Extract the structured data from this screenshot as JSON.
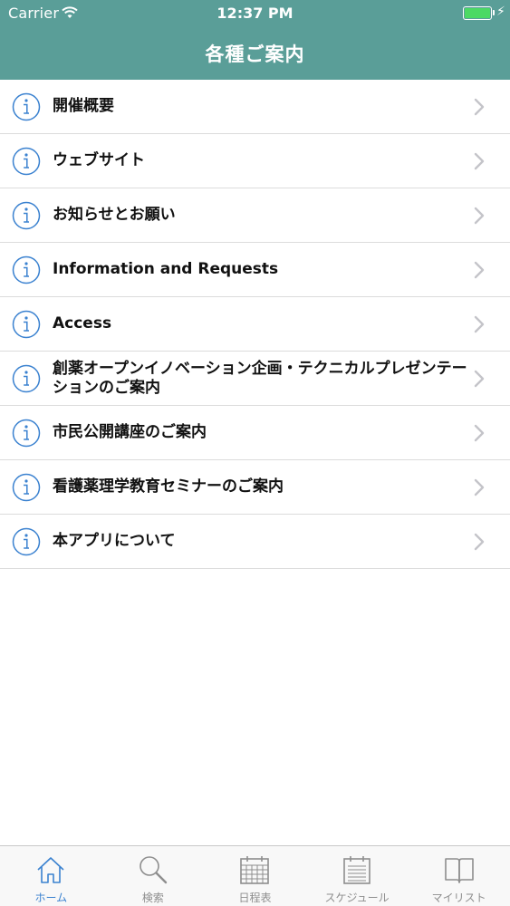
{
  "status": {
    "carrier": "Carrier",
    "time": "12:37 PM"
  },
  "nav": {
    "title": "各種ご案内"
  },
  "list": {
    "items": [
      {
        "label": "開催概要"
      },
      {
        "label": "ウェブサイト"
      },
      {
        "label": "お知らせとお願い"
      },
      {
        "label": "Information and Requests"
      },
      {
        "label": "Access"
      },
      {
        "label": "創薬オープンイノベーション企画・テクニカルプレゼンテーションのご案内"
      },
      {
        "label": "市民公開講座のご案内"
      },
      {
        "label": "看護薬理学教育セミナーのご案内"
      },
      {
        "label": "本アプリについて"
      }
    ]
  },
  "tabbar": {
    "tabs": [
      {
        "label": "ホーム",
        "icon": "home-icon",
        "active": true
      },
      {
        "label": "検索",
        "icon": "search-icon"
      },
      {
        "label": "日程表",
        "icon": "calendar-icon"
      },
      {
        "label": "スケジュール",
        "icon": "schedule-icon"
      },
      {
        "label": "マイリスト",
        "icon": "book-icon"
      }
    ]
  },
  "colors": {
    "header": "#5a9e98",
    "accent": "#3b82d0",
    "battery": "#4cd964"
  }
}
